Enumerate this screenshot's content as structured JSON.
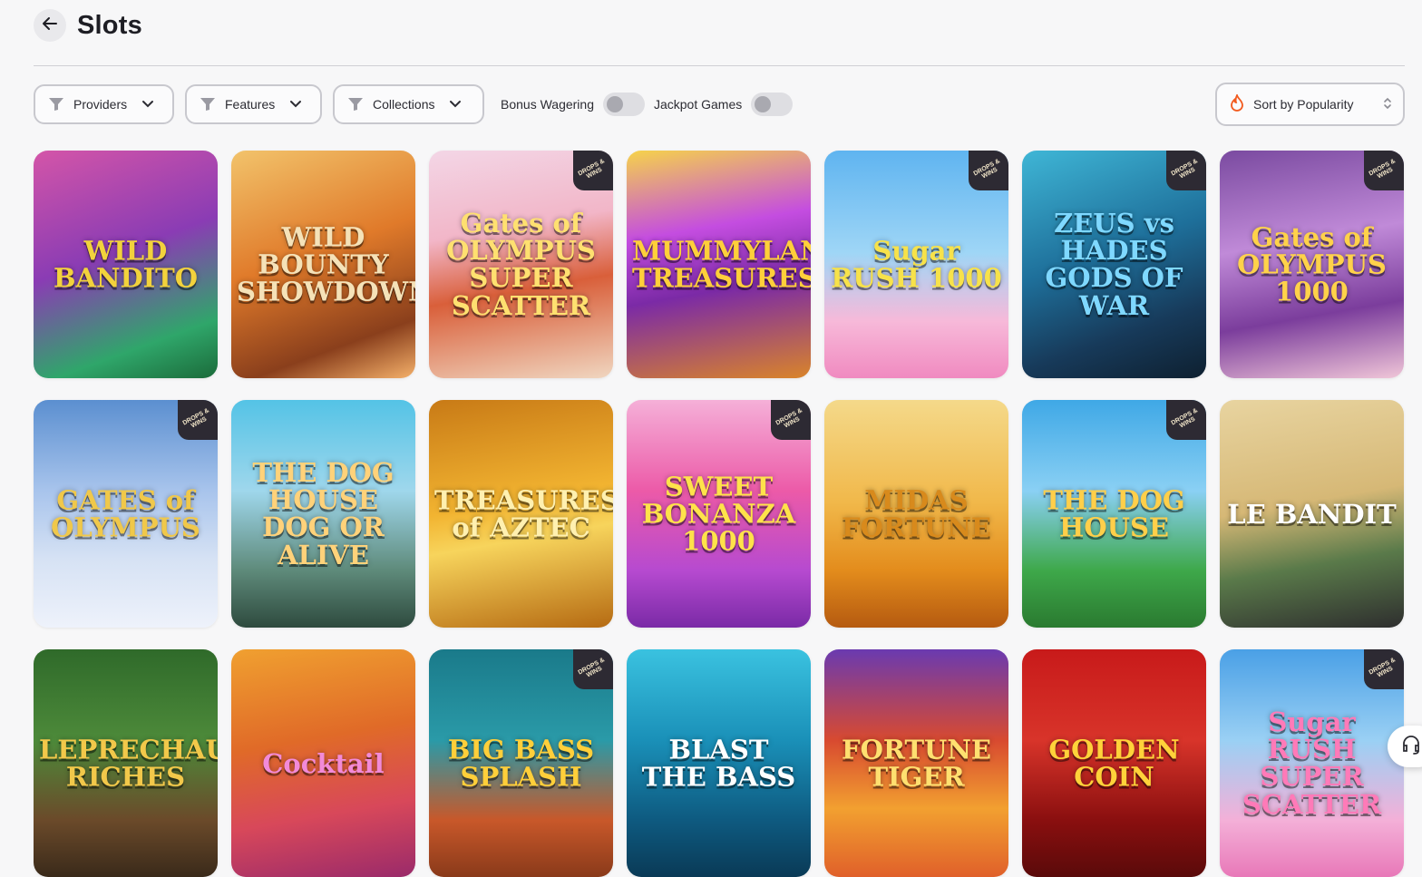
{
  "header": {
    "title": "Slots"
  },
  "filters": {
    "providers": "Providers",
    "features": "Features",
    "collections": "Collections",
    "bonus_wagering": "Bonus Wagering",
    "jackpot_games": "Jackpot Games",
    "sort": "Sort by Popularity"
  },
  "badge_text": "DROPS & WINS",
  "games": [
    {
      "title": "WILD BANDITO",
      "bg": "linear-gradient(160deg,#d455a8 0%,#8a3cb4 45%,#2fa66a 80%,#1b6b3a 100%)",
      "color": "#f2d23c",
      "badge": false
    },
    {
      "title": "WILD BOUNTY SHOWDOWN",
      "bg": "linear-gradient(160deg,#f2c36b 0%,#e07a2a 45%,#8a3f1c 80%,#f4b06a 100%)",
      "color": "#f5e2b8",
      "badge": false
    },
    {
      "title": "Gates of OLYMPUS SUPER SCATTER",
      "bg": "linear-gradient(170deg,#f3d6e6 0%,#f2b6c8 35%,#d95f3a 60%,#f0d6c0 100%)",
      "color": "#ffe070",
      "badge": true
    },
    {
      "title": "MUMMYLAND TREASURES",
      "bg": "linear-gradient(170deg,#f6d34a 0%,#c44de0 35%,#7b2aa6 60%,#d9842a 100%)",
      "color": "#ffcf3a",
      "badge": false
    },
    {
      "title": "Sugar RUSH 1000",
      "bg": "linear-gradient(180deg,#5fb4f0 0%,#9fd6f6 45%,#f7b9d9 75%,#f08ac0 100%)",
      "color": "#f7e24a",
      "badge": true
    },
    {
      "title": "ZEUS vs HADES GODS OF WAR",
      "bg": "linear-gradient(160deg,#3fb6d6 0%,#1e6f9a 45%,#173a5a 75%,#0e2030 100%)",
      "color": "#7fd8ff",
      "badge": true
    },
    {
      "title": "Gates of OLYMPUS 1000",
      "bg": "linear-gradient(170deg,#7a4aa0 0%,#c08ad8 40%,#7b3d9c 70%,#f0c6d8 100%)",
      "color": "#ffd24a",
      "badge": true
    },
    {
      "title": "GATES of OLYMPUS",
      "bg": "linear-gradient(180deg,#5b8fd0 0%,#a8c4ec 40%,#d6e2f4 70%,#eef2fb 100%)",
      "color": "#f0c84a",
      "badge": true
    },
    {
      "title": "THE DOG HOUSE DOG OR ALIVE",
      "bg": "linear-gradient(180deg,#54c3e6 0%,#9fd7ec 40%,#5e8a7a 75%,#2e4a3e 100%)",
      "color": "#ffd27a",
      "badge": false
    },
    {
      "title": "TREASURES of AZTEC",
      "bg": "linear-gradient(170deg,#c87a16 0%,#f2b431 45%,#f7d45c 60%,#b56a12 100%)",
      "color": "#fff0b0",
      "badge": false
    },
    {
      "title": "SWEET BONANZA 1000",
      "bg": "linear-gradient(180deg,#f5b0d8 0%,#ec5aa8 40%,#b64ad0 75%,#7a2aa6 100%)",
      "color": "#ffe24a",
      "badge": true
    },
    {
      "title": "MIDAS FORTUNE",
      "bg": "linear-gradient(180deg,#f4d98a 0%,#f1b84a 45%,#e38c1c 75%,#b55a10 100%)",
      "color": "#d88a1c",
      "badge": false
    },
    {
      "title": "THE DOG HOUSE",
      "bg": "linear-gradient(180deg,#3fa8e6 0%,#8ad0f4 40%,#3ea84a 75%,#2a7a30 100%)",
      "color": "#ffcf4a",
      "badge": true
    },
    {
      "title": "LE BANDIT",
      "bg": "linear-gradient(170deg,#e8d4a0 0%,#d6b876 45%,#5a7a4a 70%,#2e2e2e 100%)",
      "color": "#ffffff",
      "badge": false
    },
    {
      "title": "LEPRECHAUN RICHES",
      "bg": "linear-gradient(180deg,#2f6a2a 0%,#4d8a3a 40%,#6b4a2a 75%,#3a2a1a 100%)",
      "color": "#f2c84a",
      "badge": false
    },
    {
      "title": "Cocktail",
      "bg": "linear-gradient(170deg,#f0a030 0%,#e06a28 40%,#d8485a 70%,#9a2a6a 100%)",
      "color": "#f28ad8",
      "badge": false
    },
    {
      "title": "BIG BASS SPLASH",
      "bg": "linear-gradient(180deg,#1a7a8a 0%,#2a9aa8 40%,#c8582a 75%,#8a3a1a 100%)",
      "color": "#ffcf3a",
      "badge": true
    },
    {
      "title": "BLAST THE BASS",
      "bg": "linear-gradient(180deg,#3ac2e0 0%,#1a90b8 40%,#0e5a80 75%,#0a3a56 100%)",
      "color": "#ffffff",
      "badge": false
    },
    {
      "title": "FORTUNE TIGER",
      "bg": "linear-gradient(180deg,#6a3ab0 0%,#d84a30 40%,#f2a030 70%,#e0602a 100%)",
      "color": "#ffe070",
      "badge": false
    },
    {
      "title": "GOLDEN COIN",
      "bg": "linear-gradient(180deg,#c81a1a 0%,#d8342a 40%,#8a0f0f 75%,#5a0a0a 100%)",
      "color": "#ffd23a",
      "badge": false
    },
    {
      "title": "Sugar RUSH SUPER SCATTER",
      "bg": "linear-gradient(180deg,#4aa0e6 0%,#9ad0f4 40%,#f4b0d8 75%,#e878b8 100%)",
      "color": "#ff7ab8",
      "badge": true
    }
  ]
}
